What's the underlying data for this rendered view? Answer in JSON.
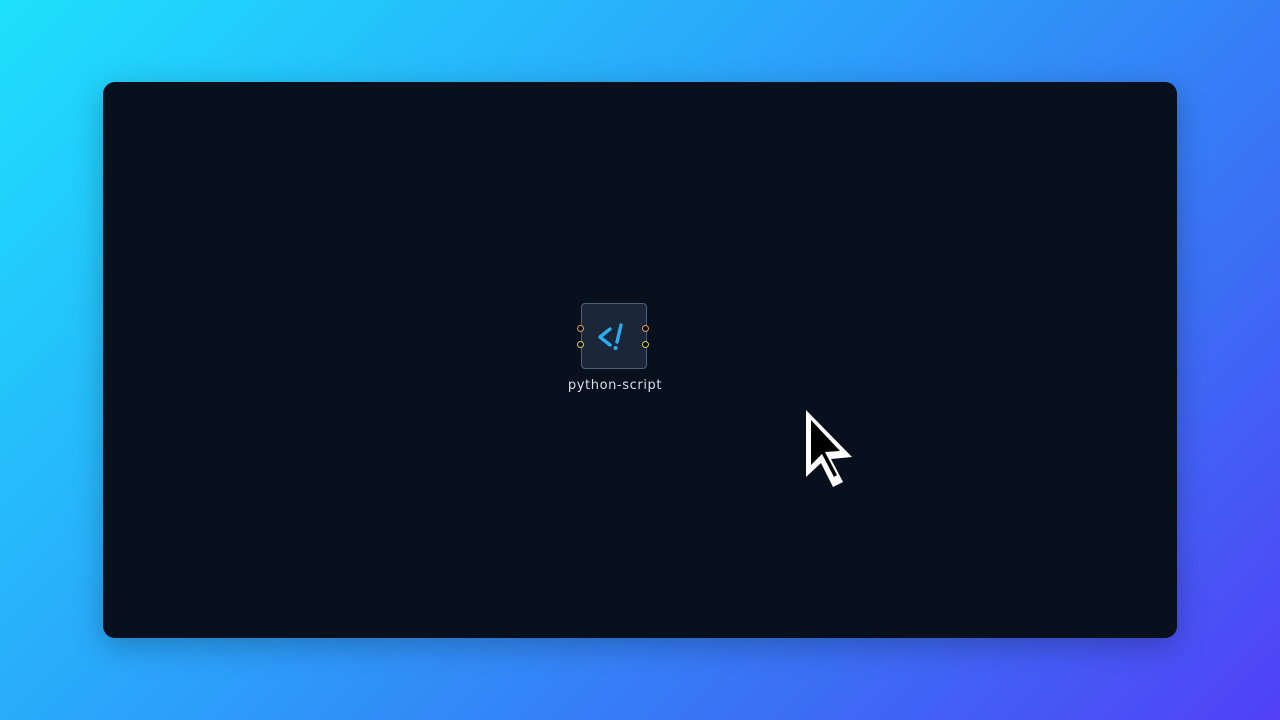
{
  "canvas": {
    "background_color": "#07101c"
  },
  "node": {
    "label": "python-script",
    "icon": "code-icon",
    "accent_color": "#29aef2",
    "ports": {
      "inputs": [
        "orange",
        "yellow"
      ],
      "outputs": [
        "orange",
        "yellow"
      ]
    }
  },
  "cursor": {
    "icon": "mouse-pointer-icon"
  }
}
